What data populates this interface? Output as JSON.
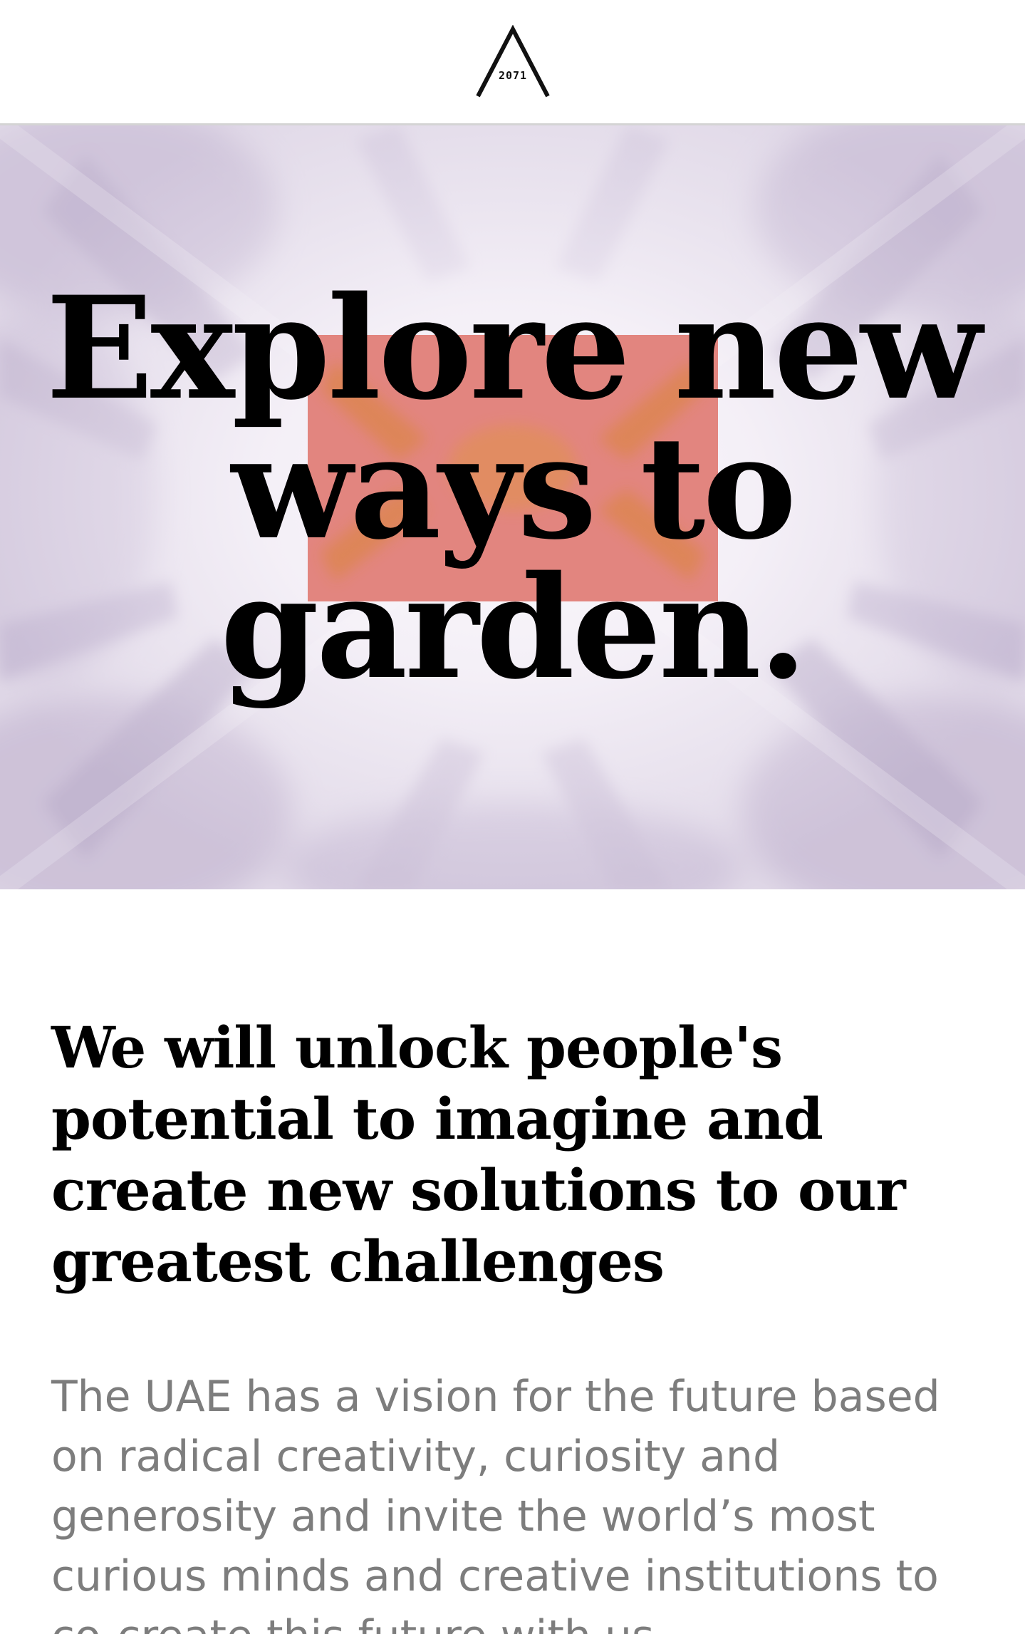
{
  "header": {
    "logo_text": "2071",
    "logo_icon": "triangle-a-logo-icon"
  },
  "hero": {
    "title_line_1": "Explore new",
    "title_line_2": "ways to",
    "title_line_3": "garden.",
    "accent_color": "#e2857f",
    "background_image": "purple-crystal-kaleidoscope"
  },
  "content": {
    "mission": "We will unlock people's potential to imagine and create new solutions to our greatest challenges",
    "vision": "The UAE has a vision for the future based on radical creativity, curiosity and generosity and invite the world’s most curious minds and creative institutions to co-create this future with us."
  }
}
